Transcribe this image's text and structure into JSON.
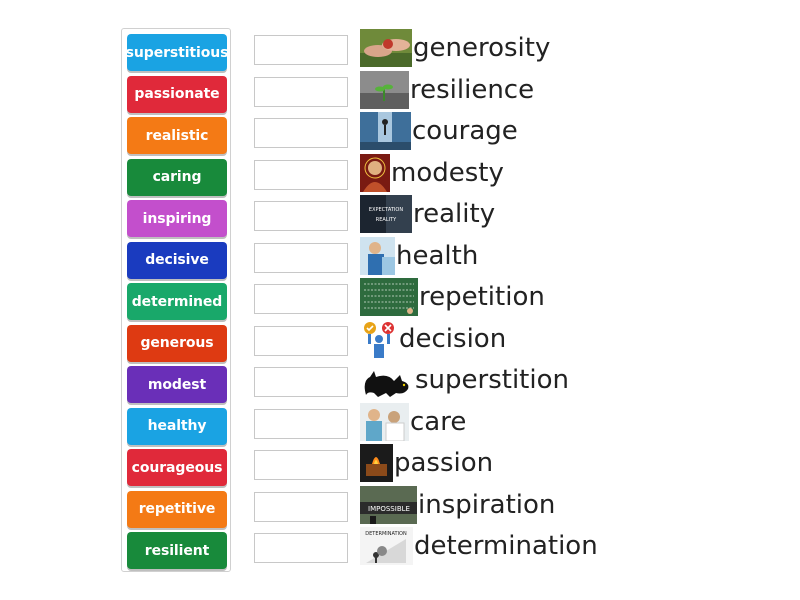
{
  "adjectives": [
    {
      "label": "superstitious",
      "color": "#1aa3e3"
    },
    {
      "label": "passionate",
      "color": "#e0293a"
    },
    {
      "label": "realistic",
      "color": "#f47a15"
    },
    {
      "label": "caring",
      "color": "#188a3b"
    },
    {
      "label": "inspiring",
      "color": "#c34fcc"
    },
    {
      "label": "decisive",
      "color": "#1a3bbf"
    },
    {
      "label": "determined",
      "color": "#19a86a"
    },
    {
      "label": "generous",
      "color": "#de3a12"
    },
    {
      "label": "modest",
      "color": "#6a2fb8"
    },
    {
      "label": "healthy",
      "color": "#1aa3e3"
    },
    {
      "label": "courageous",
      "color": "#e0293a"
    },
    {
      "label": "repetitive",
      "color": "#f47a15"
    },
    {
      "label": "resilient",
      "color": "#188a3b"
    }
  ],
  "nouns": [
    {
      "label": "generosity",
      "image": "generosity-photo"
    },
    {
      "label": "resilience",
      "image": "resilience-photo"
    },
    {
      "label": "courage",
      "image": "courage-photo"
    },
    {
      "label": "modesty",
      "image": "modesty-photo"
    },
    {
      "label": "reality",
      "image": "reality-photo"
    },
    {
      "label": "health",
      "image": "health-photo"
    },
    {
      "label": "repetition",
      "image": "repetition-photo"
    },
    {
      "label": "decision",
      "image": "decision-icon"
    },
    {
      "label": "superstition",
      "image": "black-cat-icon"
    },
    {
      "label": "care",
      "image": "care-photo"
    },
    {
      "label": "passion",
      "image": "passion-photo"
    },
    {
      "label": "inspiration",
      "image": "inspiration-photo"
    },
    {
      "label": "determination",
      "image": "determination-photo"
    }
  ],
  "thumb_text": {
    "reality_caption": "EXPECTATION REALITY",
    "inspiration_caption": "IMPOSSIBLE",
    "determination_caption": "DETERMINATION"
  }
}
